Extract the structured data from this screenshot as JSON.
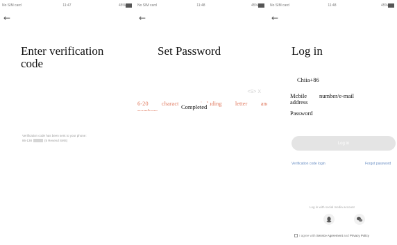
{
  "screens": {
    "verify": {
      "status_carrier": "No SIM card",
      "status_time": "11:47",
      "status_right": "45%",
      "back_icon": "arrow-left-icon",
      "title": "Enter verification code",
      "hint_line1": "Verification code has been sent to your phone:",
      "hint_prefix": "86-138",
      "hint_resend": "(5 Resend SMS)"
    },
    "set_password": {
      "status_carrier": "No SIM card",
      "status_time": "11:48",
      "status_right": "45%",
      "back_icon": "arrow-left-icon",
      "title": "Set Password",
      "toggle_icons": "<S> X",
      "rule_line1": "6-20 characters, irrJuding letter and",
      "rule_line2": "numbers",
      "completed_label": "Completed"
    },
    "login": {
      "status_carrier": "No SIM card",
      "status_time": "11:48",
      "status_right": "45%",
      "back_icon": "arrow-left-icon",
      "title": "Log in",
      "country": "Chiia+86",
      "account_label_1": "Mcbile",
      "account_label_2": "number/e-mail",
      "account_label_3": "address",
      "password_label": "Password",
      "login_button": "Log in",
      "verify_login_link": "Verification code login",
      "forgot_link": "Forgot password",
      "social_label": "Log in with social media account",
      "social_icons": [
        "qq-icon",
        "wechat-icon"
      ],
      "agree_prefix": "I agree with",
      "agree_service": "Service Agreement",
      "agree_and": "and",
      "agree_privacy": "Privacy Policy"
    }
  },
  "colors": {
    "rule_text": "#e07a5f",
    "link": "#6a8fc4",
    "button_disabled": "#e4e4e4"
  }
}
